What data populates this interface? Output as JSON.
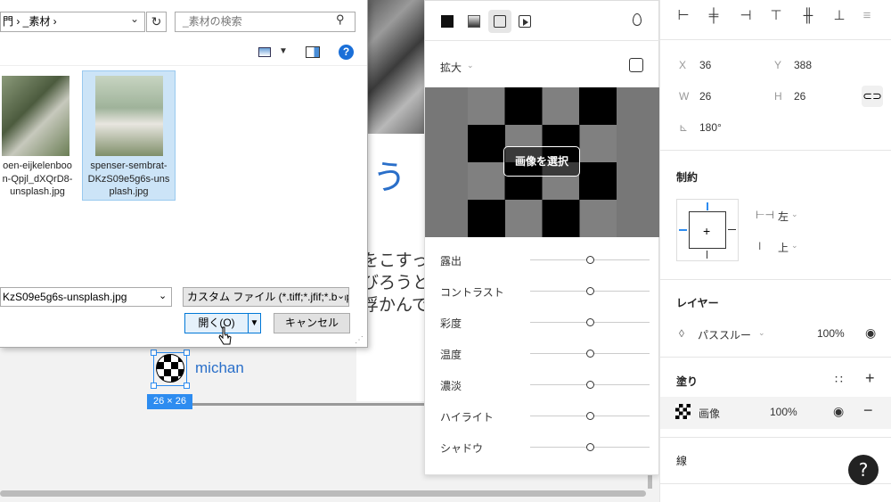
{
  "canvas": {
    "big_char": "う",
    "text_lines": [
      "をこすっ",
      "びろうと",
      "浮かんで"
    ],
    "user_name": "michan",
    "size_badge": "26 × 26"
  },
  "dialog": {
    "address": "門 › _素材 ›",
    "refresh": "↻",
    "search_placeholder": "_素材の検索",
    "files": [
      {
        "name": "oen-eijkelenboon-Qpjl_dXQrD8-unsplash.jpg",
        "lines": [
          "oen-eijkelenboo",
          "n-Qpjl_dXQrD8-",
          "unsplash.jpg"
        ],
        "selected": false
      },
      {
        "name": "spenser-sembrat-DKzS09e5g6s-unsplash.jpg",
        "lines": [
          "spenser-sembrat-",
          "DKzS09e5g6s-uns",
          "plash.jpg"
        ],
        "selected": true
      }
    ],
    "filename_value": "KzS09e5g6s-unsplash.jpg",
    "filetype_value": "カスタム ファイル (*.tiff;*.jfif;*.bmp;",
    "open_label": "開く(O)",
    "cancel_label": "キャンセル",
    "help": "?"
  },
  "fill_panel": {
    "scale_label": "拡大",
    "select_image_label": "画像を選択",
    "adjustments": [
      {
        "label": "露出",
        "value": 0
      },
      {
        "label": "コントラスト",
        "value": 0
      },
      {
        "label": "彩度",
        "value": 0
      },
      {
        "label": "温度",
        "value": 0
      },
      {
        "label": "濃淡",
        "value": 0
      },
      {
        "label": "ハイライト",
        "value": 0
      },
      {
        "label": "シャドウ",
        "value": 0
      }
    ]
  },
  "props": {
    "x_label": "X",
    "x_value": "36",
    "y_label": "Y",
    "y_value": "388",
    "w_label": "W",
    "w_value": "26",
    "h_label": "H",
    "h_value": "26",
    "rotation": "180°",
    "constraints_title": "制約",
    "constraint_h": "左",
    "constraint_v": "上",
    "layer_title": "レイヤー",
    "blend_mode": "パススルー",
    "layer_opacity": "100%",
    "fill_title": "塗り",
    "fill_type": "画像",
    "fill_opacity": "100%",
    "stroke_title": "線",
    "help": "?"
  },
  "colors": {
    "accent": "#2d8cf0",
    "link": "#2a6fc9",
    "dialog_button_border": "#0078d7"
  }
}
